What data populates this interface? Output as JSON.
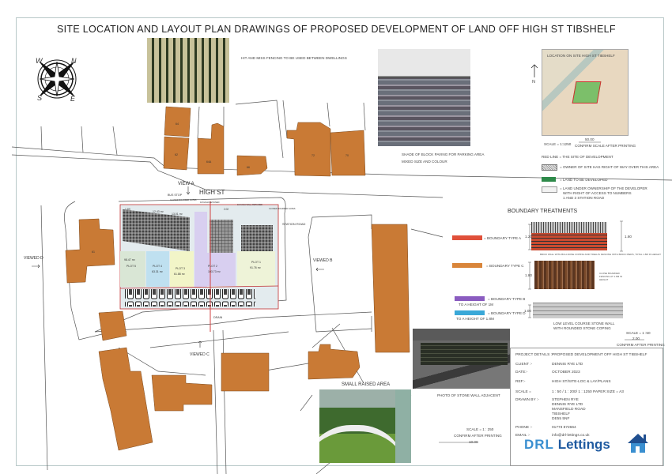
{
  "title": "SITE LOCATION AND LAYOUT PLAN DRAWINGS OF PROPOSED DEVELOPMENT OF LAND OFF HIGH ST TIBSHELF",
  "compass": {
    "labels": [
      "N",
      "E",
      "S",
      "W"
    ]
  },
  "fence_photo": {
    "caption": "HIT AND MISS FENCING TO BE USED BETWEEN DWELLINGS"
  },
  "paving_photo": {
    "caption_line1": "SHADE OF BLOCK PAVING FOR PARKING AREA",
    "caption_line2": "MIXED SIZE AND COLOUR"
  },
  "location_map": {
    "label": "LOCATION ON SITE HIGH ST TIBSHELF",
    "north": "N",
    "scale": "SCALE = 1:1250",
    "scale_bar": "50.00",
    "confirm": "CONFIRM SCALE AFTER PRINTING"
  },
  "legend": {
    "red_line": "RED LINE = THE SITE OF DEVELOPMENT",
    "hatched": "= OWNER OF SITE HAS RIGHT OF WAY OVER THIS AREA",
    "green": "= LAND TO BE DEVELOPED",
    "grey_line1": "= LAND UNDER OWNERSHIP OF THE DEVELOPER",
    "grey_line2": "WITH RIGHT OF ACCESS TO NUMBERS",
    "grey_line3": "1 AND 3 STATION ROAD"
  },
  "boundary": {
    "heading": "BOUNDARY TREATMENTS",
    "type_a": "= BOUNDARY TYPE A",
    "type_c": "= BOUNDARY TYPE C",
    "type_b": "= BOUNDARY TYPE B",
    "type_b_note": "TO A HEIGHT OF 1M",
    "type_d": "= BOUNDARY TYPE D",
    "type_d_note": "TO A HEIGHT OF 1.8M",
    "a_height_left": "1.20",
    "a_height_right": "1.80",
    "a_caption": "BRICK WALL WITH BULLNOSE COPING AND TRELLIS FENCING WITH BRICK PIERS, TOTAL 1.8M IN HEIGHT",
    "c_height": "1.80",
    "c_caption": "CLOSE BOARDED FENCING AT 1.8M IN HEIGHT",
    "d_height": "1.00",
    "d_caption_line1": "LOW LEVEL COURSE STONE WALL",
    "d_caption_line2": "WITH ROUNDED STONE COPING",
    "colors": {
      "type_a": "#e0503a",
      "type_c": "#d9853a",
      "type_b": "#8a5cc0",
      "type_d": "#3aa8d8",
      "green": "#2e8a4a"
    },
    "scale": "SCALE = 1 :50",
    "scale_bar": "2.00",
    "confirm": "CONFIRM AFTER PRINTING"
  },
  "stone_photo": {
    "caption": "PHOTO OF STONE WALL ADJACENT"
  },
  "raised_area": {
    "label": "SMALL RAISED AREA"
  },
  "plan_scale": {
    "scale": "SCALE = 1 : 250",
    "confirm": "CONFIRM AFTER PRINTING",
    "scale_bar": "10.00"
  },
  "project": {
    "details_label": "PROJECT DETAILS :-",
    "details": "PROPOSED DEVELOPMENT OFF HIGH ST TIBSHELF",
    "client_label": "CLIENT :-",
    "client": "DENNIS RYE LTD",
    "date_label": "DATE:-",
    "date": "OCTOBER 2023",
    "ref_label": "REF:-",
    "ref": "HIGH ST/SITE-LOC & LAY/PLANS",
    "scale_label": "SCALE =",
    "scale": "1 : 50 / 1 : 200/ 1 : 1250   PAPER SIZE = A3",
    "drawn_label": "DRAWN BY :-",
    "drawn": [
      "STEPHEN RYE",
      "DENNIS RYE LTD",
      "MANSFIELD ROAD",
      "TIBSHELF",
      "DE55 5NF"
    ],
    "phone_label": "PHONE :-",
    "phone": "01773 872664",
    "email_label": "EMAIL :-",
    "email": "info@drl-lettings.co.uk",
    "logo_drl": "DRL",
    "logo_lettings": "Lettings"
  },
  "map_labels": {
    "view_a": "VIEW A",
    "high_st": "HIGH ST",
    "bus_stop": "BUS STOP",
    "station_road": "STATION ROAD",
    "viewed_b": "VIEWED B",
    "viewed_c": "VIEWED C",
    "viewed_d": "VIEWED D",
    "drain": "DRAIN",
    "gates_left": "CLOSED BOARDED GATES",
    "wall_retained": "1M HIGH RETAINED",
    "wall_retained2": "1M HIGH WALL RETAINED",
    "gates_right": "CLOSED BOARDED GATES",
    "area_a": "1.89",
    "area_b": "12.43 m²",
    "area_c": "13.01 m²",
    "dim": "2.02",
    "plot5": "PLOT 5",
    "plot5_area": "98.47 m²",
    "plot4": "PLOT 4",
    "plot4_area": "63.31 m²",
    "plot3": "PLOT 3",
    "plot3_area": "61.88 m²",
    "plot2": "PLOT 2",
    "plot2_area": "103.73 m²",
    "plot1": "PLOT 1",
    "plot1_area": "91.76 m²",
    "bldg_64": "64",
    "bldg_62": "62",
    "bldg_64a": "64A",
    "bldg_66": "66",
    "bldg_72": "72",
    "bldg_70": "70",
    "bldg_61": "61"
  }
}
